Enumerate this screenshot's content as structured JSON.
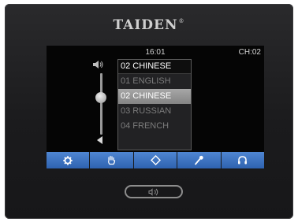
{
  "device": {
    "brand": "TAIDEN",
    "brand_mark": "®"
  },
  "status": {
    "time": "16:01",
    "channel": "CH:02"
  },
  "language_list": {
    "current": "02 CHINESE",
    "items": [
      {
        "label": "01 ENGLISH",
        "selected": false
      },
      {
        "label": "02 CHINESE",
        "selected": true
      },
      {
        "label": "03 RUSSIAN",
        "selected": false
      },
      {
        "label": "04 FRENCH",
        "selected": false
      }
    ]
  },
  "volume": {
    "level": 0.6
  },
  "toolbar": {
    "buttons": [
      {
        "icon": "gear-icon"
      },
      {
        "icon": "hand-icon"
      },
      {
        "icon": "diamond-icon"
      },
      {
        "icon": "microphone-icon"
      },
      {
        "icon": "headphones-icon"
      }
    ]
  },
  "hardware_button": {
    "icon": "speaker-icon"
  },
  "colors": {
    "toolbar_blue": "#3a72c4",
    "selected_row": "#9a9a9a",
    "screen_bg": "#050505",
    "device_bg": "#1e1e20"
  }
}
